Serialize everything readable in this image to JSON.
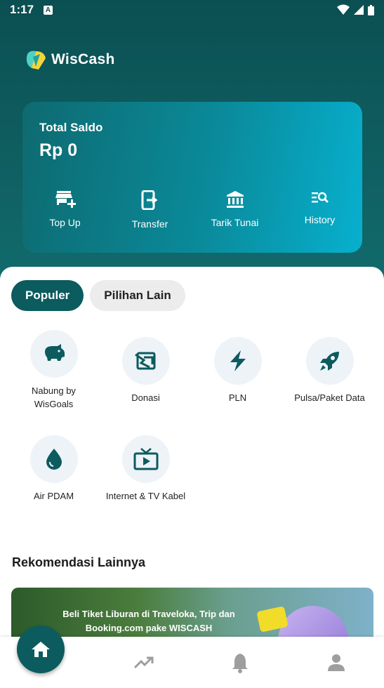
{
  "status_bar": {
    "time": "1:17",
    "notification_badge": "A"
  },
  "app": {
    "name": "WisCash"
  },
  "balance": {
    "label": "Total Saldo",
    "value": "Rp 0"
  },
  "card_actions": [
    {
      "label": "Top Up",
      "icon": "store-plus-icon"
    },
    {
      "label": "Transfer",
      "icon": "transfer-icon"
    },
    {
      "label": "Tarik Tunai",
      "icon": "bank-icon"
    },
    {
      "label": "History",
      "icon": "history-search-icon"
    }
  ],
  "tabs": [
    {
      "label": "Populer",
      "active": true
    },
    {
      "label": "Pilihan Lain",
      "active": false
    }
  ],
  "services": [
    {
      "label": "Nabung by WisGoals",
      "icon": "piggy-bank-icon"
    },
    {
      "label": "Donasi",
      "icon": "donation-icon"
    },
    {
      "label": "PLN",
      "icon": "lightning-icon"
    },
    {
      "label": "Pulsa/Paket Data",
      "icon": "rocket-icon"
    },
    {
      "label": "Air PDAM",
      "icon": "water-drop-icon"
    },
    {
      "label": "Internet & TV Kabel",
      "icon": "tv-icon"
    }
  ],
  "recommendations": {
    "title": "Rekomendasi Lainnya",
    "banner_text": "Beli Tiket Liburan di Traveloka, Trip dan Booking.com pake WISCASH"
  },
  "bottom_nav": [
    {
      "name": "home",
      "icon": "home-icon"
    },
    {
      "name": "trending",
      "icon": "trending-up-icon"
    },
    {
      "name": "notifications",
      "icon": "bell-icon"
    },
    {
      "name": "profile",
      "icon": "person-icon"
    }
  ],
  "colors": {
    "primary": "#0c5b5e",
    "accent": "#07b0cf",
    "icon_circle": "#eef3f8"
  }
}
